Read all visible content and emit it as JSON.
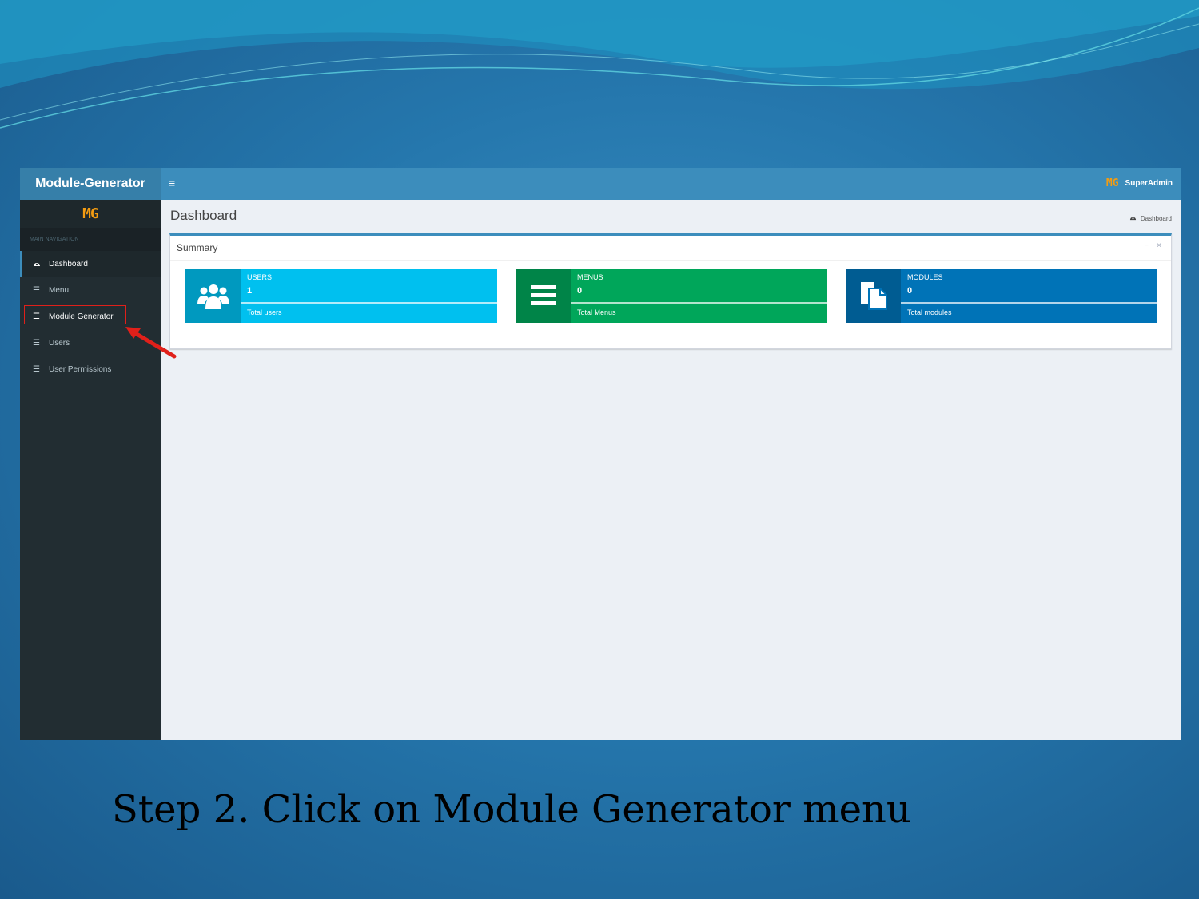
{
  "app": {
    "brand": "Module-Generator",
    "logo": "MG",
    "user_name": "SuperAdmin"
  },
  "sidebar": {
    "header": "MAIN NAVIGATION",
    "items": [
      {
        "label": "Dashboard",
        "icon": "dashboard-icon",
        "active": true
      },
      {
        "label": "Menu",
        "icon": "list-icon"
      },
      {
        "label": "Module Generator",
        "icon": "list-icon",
        "highlighted": true
      },
      {
        "label": "Users",
        "icon": "list-icon"
      },
      {
        "label": "User Permissions",
        "icon": "list-icon"
      }
    ]
  },
  "main": {
    "page_title": "Dashboard",
    "breadcrumb": "Dashboard",
    "box_title": "Summary",
    "cards": [
      {
        "label": "USERS",
        "value": "1",
        "description": "Total users",
        "color": "#00c0ef",
        "icon": "users-icon"
      },
      {
        "label": "MENUS",
        "value": "0",
        "description": "Total Menus",
        "color": "#00a65a",
        "icon": "list-icon"
      },
      {
        "label": "MODULES",
        "value": "0",
        "description": "Total modules",
        "color": "#0073b7",
        "icon": "files-icon"
      }
    ]
  },
  "caption": "Step 2. Click on Module Generator menu",
  "colors": {
    "highlight": "#e0201a",
    "arrow": "#e0201a"
  }
}
